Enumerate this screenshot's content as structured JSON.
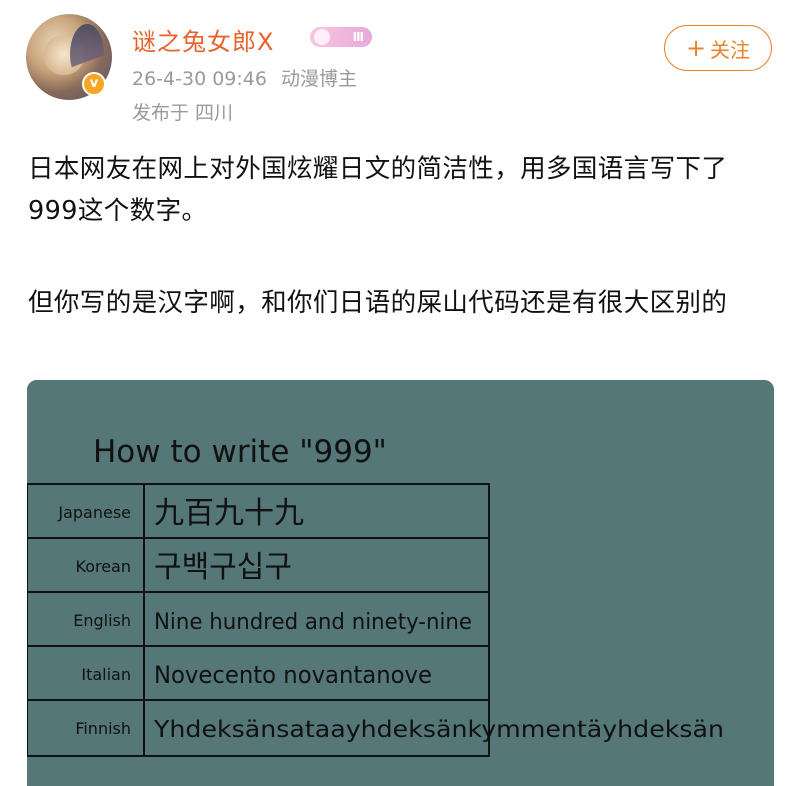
{
  "user": {
    "name": "谜之兔女郎X",
    "level_badge": "Ⅲ",
    "timestamp": "26-4-30 09:46",
    "role": "动漫博主",
    "location": "发布于 四川",
    "verified_symbol": "v"
  },
  "follow_button": {
    "plus": "+",
    "label": "关注"
  },
  "post": {
    "paragraph1": "日本网友在网上对外国炫耀日文的简洁性，用多国语言写下了999这个数字。",
    "paragraph2": "但你写的是汉字啊，和你们日语的屎山代码还是有很大区别的"
  },
  "image": {
    "title": "How to write \"999\"",
    "rows": [
      {
        "language": "Japanese",
        "text": "九百九十九"
      },
      {
        "language": "Korean",
        "text": "구백구십구"
      },
      {
        "language": "English",
        "text": "Nine hundred and ninety-nine"
      },
      {
        "language": "Italian",
        "text": "Novecento novantanove"
      },
      {
        "language": "Finnish",
        "text": "Yhdeksänsataayhdeksänkymmentäyhdeksän"
      }
    ]
  },
  "colors": {
    "username": "#e8622b",
    "follow_button": "#e8832b",
    "meta": "#9a9a9a",
    "board": "#557778"
  },
  "icons": [
    "verified-badge-icon",
    "plus-icon"
  ]
}
